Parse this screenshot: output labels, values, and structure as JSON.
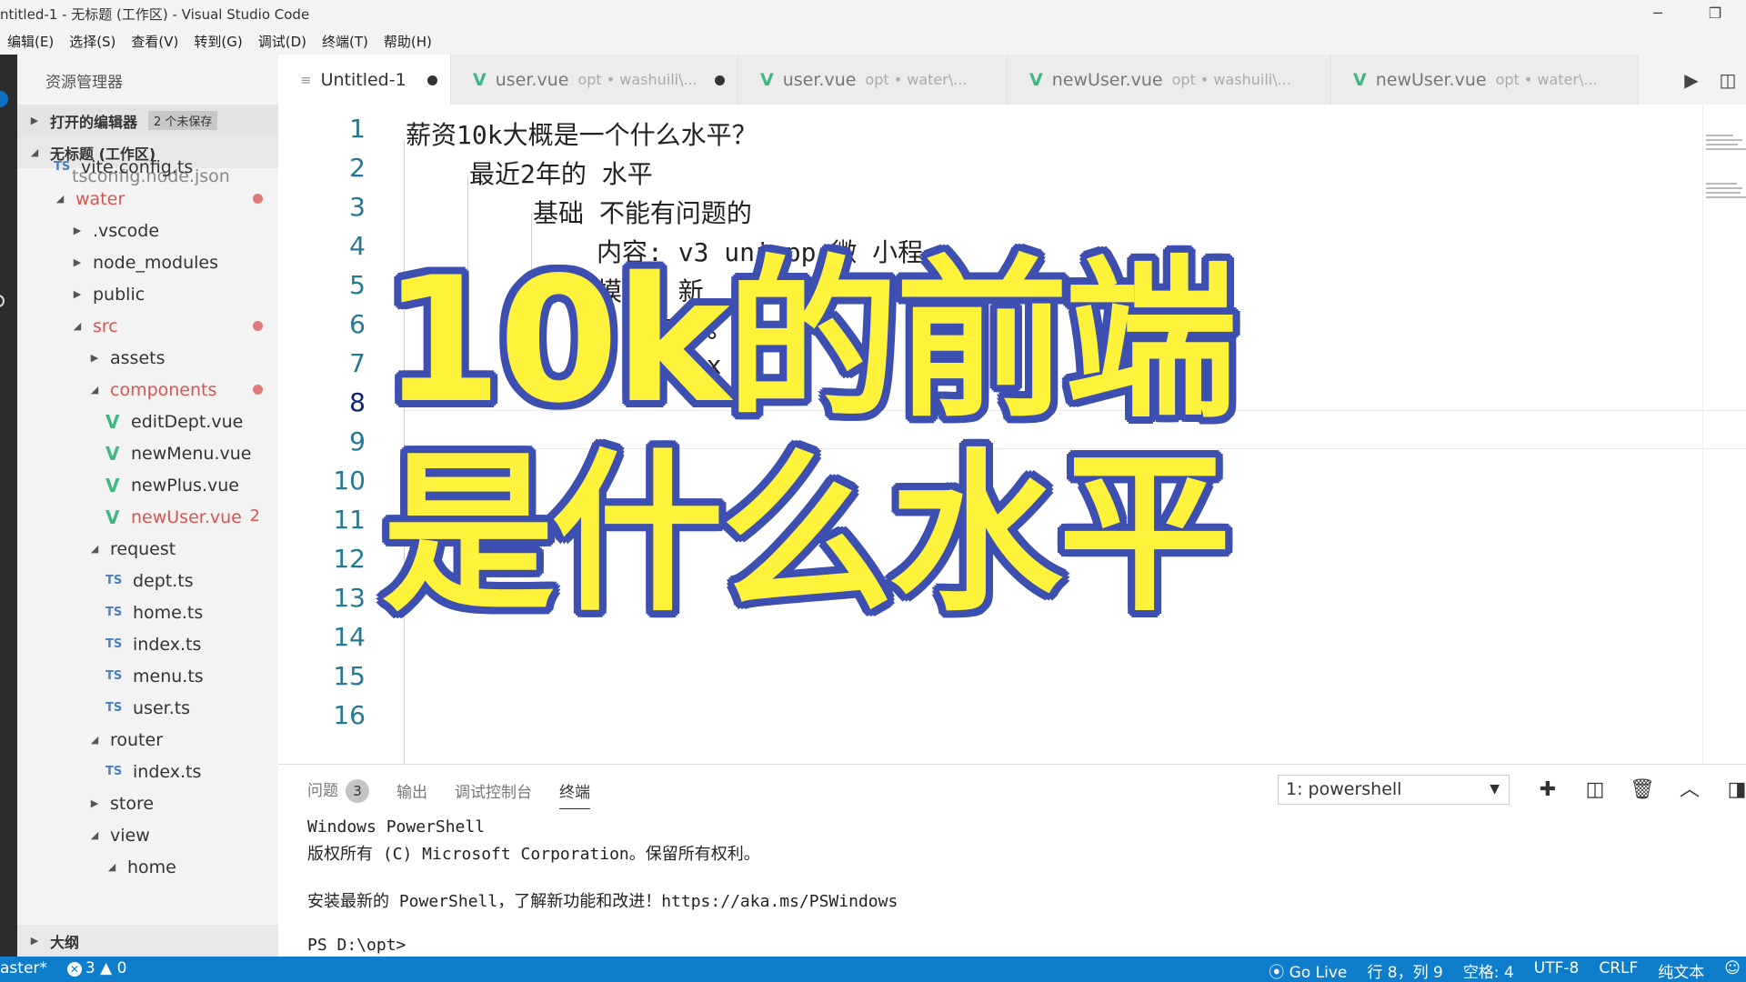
{
  "window": {
    "title": "ntitled-1 - 无标题 (工作区) - Visual Studio Code",
    "minimize": "─",
    "restore": "❐"
  },
  "menu": [
    "编辑(E)",
    "选择(S)",
    "查看(V)",
    "转到(G)",
    "调试(D)",
    "终端(T)",
    "帮助(H)"
  ],
  "sidebar": {
    "title": "资源管理器",
    "open_editors": {
      "label": "打开的编辑器",
      "badge": "2 个未保存"
    },
    "workspace": {
      "label": "无标题 (工作区)"
    },
    "cut_file": "tsconfig.node.json",
    "items": [
      {
        "label": "vite.config.ts",
        "kind": "ts",
        "indent": 1
      },
      {
        "label": "water",
        "kind": "folder-open",
        "indent": 1,
        "modified": true
      },
      {
        "label": ".vscode",
        "kind": "folder",
        "indent": 2
      },
      {
        "label": "node_modules",
        "kind": "folder",
        "indent": 2
      },
      {
        "label": "public",
        "kind": "folder",
        "indent": 2
      },
      {
        "label": "src",
        "kind": "folder-open",
        "indent": 2,
        "modified": true
      },
      {
        "label": "assets",
        "kind": "folder",
        "indent": 3
      },
      {
        "label": "components",
        "kind": "folder-open",
        "indent": 3,
        "modified": true
      },
      {
        "label": "editDept.vue",
        "kind": "vue",
        "indent": 4
      },
      {
        "label": "newMenu.vue",
        "kind": "vue",
        "indent": 4
      },
      {
        "label": "newPlus.vue",
        "kind": "vue",
        "indent": 4
      },
      {
        "label": "newUser.vue",
        "kind": "vue",
        "indent": 4,
        "modified": true,
        "count": "2"
      },
      {
        "label": "request",
        "kind": "folder-open",
        "indent": 3
      },
      {
        "label": "dept.ts",
        "kind": "ts",
        "indent": 4
      },
      {
        "label": "home.ts",
        "kind": "ts",
        "indent": 4
      },
      {
        "label": "index.ts",
        "kind": "ts",
        "indent": 4
      },
      {
        "label": "menu.ts",
        "kind": "ts",
        "indent": 4
      },
      {
        "label": "user.ts",
        "kind": "ts",
        "indent": 4
      },
      {
        "label": "router",
        "kind": "folder-open",
        "indent": 3
      },
      {
        "label": "index.ts",
        "kind": "ts",
        "indent": 4
      },
      {
        "label": "store",
        "kind": "folder",
        "indent": 3
      },
      {
        "label": "view",
        "kind": "folder-open",
        "indent": 3
      },
      {
        "label": "home",
        "kind": "folder-open",
        "indent": 4
      }
    ],
    "outline": "大纲"
  },
  "tabs": [
    {
      "label": "Untitled-1",
      "path": "",
      "active": true,
      "dirty": true,
      "icon": "lines-icon"
    },
    {
      "label": "user.vue",
      "path": "opt • washuili\\...",
      "dirty": true,
      "icon": "vue-icon"
    },
    {
      "label": "user.vue",
      "path": "opt • water\\...",
      "dirty": false,
      "icon": "vue-icon"
    },
    {
      "label": "newUser.vue",
      "path": "opt • washuili\\...",
      "dirty": false,
      "icon": "vue-icon"
    },
    {
      "label": "newUser.vue",
      "path": "opt • water\\...",
      "dirty": false,
      "icon": "vue-icon"
    }
  ],
  "editor": {
    "line_numbers": [
      "1",
      "2",
      "3",
      "4",
      "5",
      "6",
      "7",
      "8",
      "9",
      "10",
      "11",
      "12",
      "13",
      "14",
      "15",
      "16"
    ],
    "current_line": 8,
    "lines": [
      {
        "text": "薪资10k大概是一个什么水平？",
        "indent": 0
      },
      {
        "text": "最近2年的 水平",
        "indent": 1
      },
      {
        "text": "基础 不能有问题的",
        "indent": 2
      },
      {
        "text": "内容:  v3 uniapp 微 小程",
        "indent": 3
      },
      {
        "text": "模块: 新",
        "indent": 3
      },
      {
        "text": "页 %",
        "indent": 4
      },
      {
        "text": "ajax",
        "indent": 4
      }
    ]
  },
  "overlay": {
    "line1": "10k的前端",
    "line2": "是什么水平"
  },
  "panel": {
    "tabs": [
      {
        "label": "问题",
        "badge": "3"
      },
      {
        "label": "输出"
      },
      {
        "label": "调试控制台"
      },
      {
        "label": "终端",
        "active": true
      }
    ],
    "terminal_select": "1: powershell",
    "terminal_lines": [
      "Windows PowerShell",
      "版权所有 (C)  Microsoft Corporation。保留所有权利。",
      "",
      "安装最新的 PowerShell，了解新功能和改进！https://aka.ms/PSWindows",
      "",
      "PS D:\\opt>"
    ]
  },
  "statusbar": {
    "branch": "aster*",
    "errors": "3",
    "warnings": "0",
    "go_live": "Go Live",
    "position": "行 8，列 9",
    "spaces": "空格: 4",
    "encoding": "UTF-8",
    "eol": "CRLF",
    "language": "纯文本"
  },
  "colors": {
    "statusbar": "#0e7dcc",
    "overlay_fill": "#fff23a",
    "overlay_stroke": "#3d4fb0",
    "vue_green": "#41b883",
    "modified_red": "#d9534f"
  }
}
